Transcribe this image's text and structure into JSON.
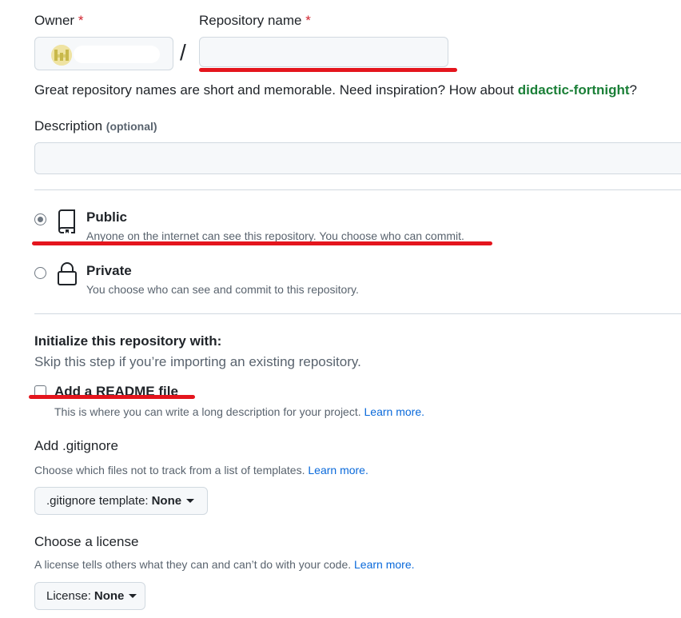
{
  "owner": {
    "label": "Owner",
    "required_mark": "*"
  },
  "repo_name": {
    "label": "Repository name",
    "required_mark": "*",
    "value": "",
    "separator": "/"
  },
  "hint": {
    "text": "Great repository names are short and memorable. Need inspiration? How about ",
    "suggestion": "didactic-fortnight",
    "end": "?"
  },
  "description": {
    "label": "Description",
    "optional": "(optional)",
    "value": ""
  },
  "visibility": {
    "public": {
      "title": "Public",
      "desc": "Anyone on the internet can see this repository. You choose who can commit.",
      "selected": true
    },
    "private": {
      "title": "Private",
      "desc": "You choose who can see and commit to this repository.",
      "selected": false
    }
  },
  "init": {
    "heading": "Initialize this repository with:",
    "sub": "Skip this step if you’re importing an existing repository.",
    "readme_label": "Add a README file",
    "readme_desc": "This is where you can write a long description for your project.",
    "readme_link": "Learn more."
  },
  "gitignore": {
    "heading": "Add .gitignore",
    "desc": "Choose which files not to track from a list of templates.",
    "link": "Learn more.",
    "button_prefix": ".gitignore template:",
    "button_value": "None"
  },
  "license": {
    "heading": "Choose a license",
    "desc": "A license tells others what they can and can’t do with your code.",
    "link": "Learn more.",
    "button_prefix": "License:",
    "button_value": "None"
  },
  "colors": {
    "accent_green": "#1a7f37",
    "link_blue": "#0969da",
    "annotation_red": "#e4151d",
    "required_red": "#d1242f"
  }
}
